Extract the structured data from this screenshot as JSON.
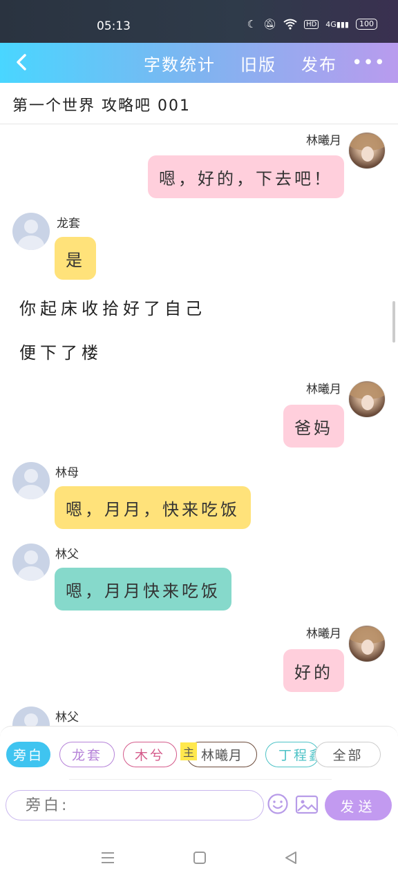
{
  "status_bar": {
    "time": "05:13",
    "network": "4G",
    "battery": "100"
  },
  "nav": {
    "links": [
      "字数统计",
      "旧版",
      "发布"
    ],
    "more": "•••"
  },
  "title": "第一个世界 攻略吧 001",
  "chat": [
    {
      "type": "message",
      "side": "right",
      "sender": "林曦月",
      "text": "嗯，好的，下去吧！",
      "color": "#ffcfdc"
    },
    {
      "type": "message",
      "side": "left",
      "sender": "龙套",
      "text": "是",
      "color": "#ffe27a"
    },
    {
      "type": "narration",
      "text": "你起床收拾好了自己"
    },
    {
      "type": "narration",
      "text": "便下了楼"
    },
    {
      "type": "message",
      "side": "right",
      "sender": "林曦月",
      "text": "爸妈",
      "color": "#ffcfdc"
    },
    {
      "type": "message",
      "side": "left",
      "sender": "林母",
      "text": "嗯，月月，快来吃饭",
      "color": "#ffe27a"
    },
    {
      "type": "message",
      "side": "left",
      "sender": "林父",
      "text": "嗯，月月快来吃饭",
      "color": "#86d9cb"
    },
    {
      "type": "message",
      "side": "right",
      "sender": "林曦月",
      "text": "好的",
      "color": "#ffcfdc"
    },
    {
      "type": "message",
      "side": "left",
      "sender": "林父",
      "text": ""
    }
  ],
  "roles": [
    {
      "label": "旁白",
      "color": "#3fc4f0",
      "active": true
    },
    {
      "label": "龙套",
      "color": "#b582d8",
      "active": false
    },
    {
      "label": "木兮",
      "color": "#d45a8a",
      "active": false
    },
    {
      "label": "林曦月",
      "color": "#6b4a3a",
      "active": false,
      "main_tag": "主"
    },
    {
      "label": "丁程鑫",
      "color": "#4cc2c6",
      "active": false
    },
    {
      "label": "全部",
      "color": "#bbbbbb",
      "active": false
    }
  ],
  "input": {
    "placeholder": "旁白:",
    "send_label": "发送"
  }
}
